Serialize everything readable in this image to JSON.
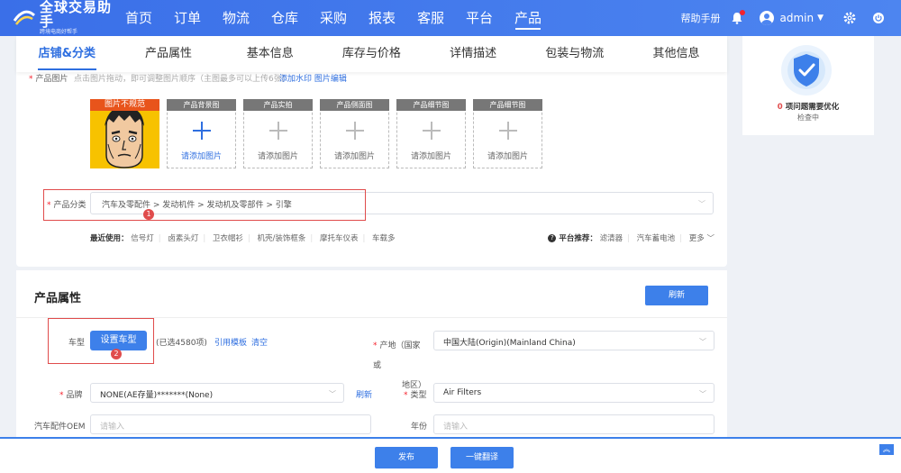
{
  "nav": {
    "logo_title": "全球交易助手",
    "logo_sub": "跨境电商好帮手",
    "items": [
      "首页",
      "订单",
      "物流",
      "仓库",
      "采购",
      "报表",
      "客服",
      "平台",
      "产品"
    ],
    "active": "产品",
    "help": "帮助手册",
    "user": "admin"
  },
  "tabs": [
    "店铺&分类",
    "产品属性",
    "基本信息",
    "库存与价格",
    "详情描述",
    "包装与物流",
    "其他信息"
  ],
  "images": {
    "label": "产品图片",
    "hint": "点击图片拖动，即可调整图片顺序（主图最多可以上传6张）",
    "links": "添加水印  图片编辑",
    "main_tag": "图片不规范",
    "slots": [
      "产品背景图",
      "产品实拍",
      "产品侧面图",
      "产品细节图",
      "产品细节图"
    ],
    "add_text": "请添加图片"
  },
  "category": {
    "label": "产品分类",
    "value": "汽车及零配件 > 发动机件 > 发动机及零部件 > 引擎",
    "badge": "1"
  },
  "recent": {
    "label": "最近使用：",
    "items": [
      "信号灯",
      "卤素头灯",
      "卫衣帽衫",
      "机壳/装饰框条",
      "摩托车仪表",
      "车载多"
    ]
  },
  "platform": {
    "label": "平台推荐：",
    "items": [
      "滤清器",
      "汽车蓄电池",
      "更多"
    ]
  },
  "attributes": {
    "title": "产品属性",
    "refresh_btn": "刷新",
    "model_label": "车型",
    "set_model_btn": "设置车型",
    "selected": "(已选4580项)",
    "cite_template": "引用模板",
    "clear": "清空",
    "badge": "2",
    "origin_label": "产地（国家或地区）",
    "origin_label_1": "产地（国家或",
    "origin_label_2": "地区）",
    "origin_value": "中国大陆(Origin)(Mainland China)",
    "brand_label": "品牌",
    "brand_value": "NONE(AE存量)*******(None)",
    "brand_refresh": "刷新",
    "type_label": "类型",
    "type_value": "Air Filters",
    "oem_label": "汽车配件OEM",
    "oem_placeholder": "请输入",
    "year_label": "年份",
    "year_placeholder": "请输入"
  },
  "side": {
    "count": "0",
    "text": "项问题需要优化",
    "sub": "检查中"
  },
  "bottom": {
    "publish": "发布",
    "translate": "一键翻译"
  }
}
